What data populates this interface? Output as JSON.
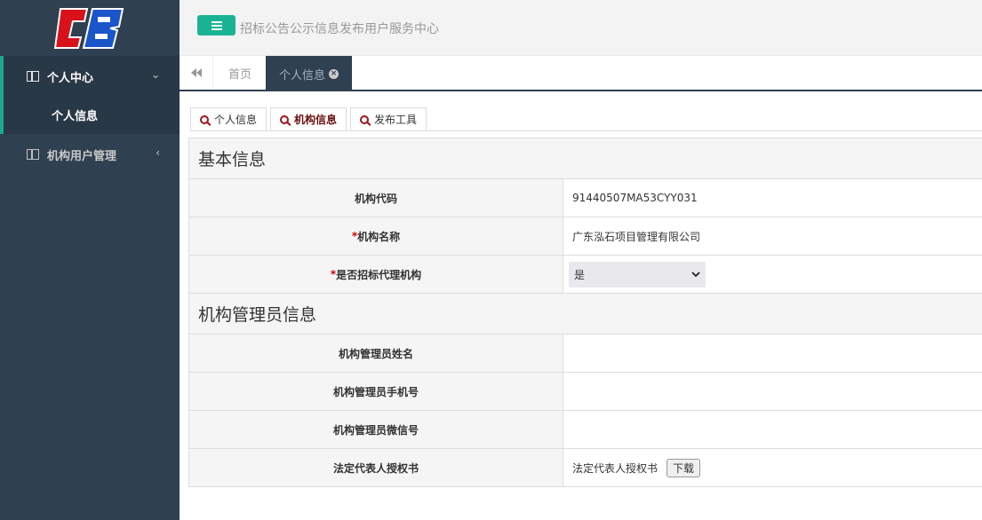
{
  "sidebar": {
    "menu": [
      {
        "label": "个人中心",
        "icon": "panel-icon",
        "arrow": "⌄",
        "children": [
          {
            "label": "个人信息"
          }
        ]
      },
      {
        "label": "机构用户管理",
        "icon": "panel-icon",
        "arrow": "‹"
      }
    ]
  },
  "header": {
    "menu_icon": "hamburger-icon",
    "site_title": "招标公告公示信息发布用户服务中心"
  },
  "tabs": {
    "back_icon": "double-left-arrow-icon",
    "items": [
      {
        "label": "首页"
      },
      {
        "label": "个人信息",
        "close": "×"
      }
    ]
  },
  "subtabs": [
    {
      "label": "个人信息",
      "icon": "search-icon"
    },
    {
      "label": "机构信息",
      "icon": "search-icon",
      "active": true
    },
    {
      "label": "发布工具",
      "icon": "search-icon"
    }
  ],
  "form": {
    "basic_title": "基本信息",
    "org_code_label": "机构代码",
    "org_code_value": "91440507MA53CYY031",
    "required_mark": "*",
    "org_name_label": "机构名称",
    "org_name_value": "广东泓石项目管理有限公司",
    "is_agency_label": "是否招标代理机构",
    "is_agency_value": "是",
    "admin_title": "机构管理员信息",
    "admin_name_label": "机构管理员姓名",
    "admin_phone_label": "机构管理员手机号",
    "admin_wechat_label": "机构管理员微信号",
    "auth_label": "法定代表人授权书",
    "auth_value": "法定代表人授权书",
    "download_label": "下载"
  },
  "colors": {
    "sidebar_bg": "#2f4050",
    "accent": "#1ab394",
    "required": "#cc0000"
  }
}
